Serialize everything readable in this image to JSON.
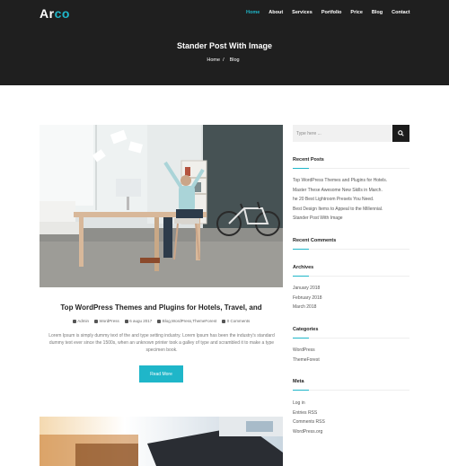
{
  "brand": {
    "name_main": "Ar",
    "name_accent": "co",
    "accent_color": "#1fb6c9"
  },
  "nav": [
    {
      "label": "Home",
      "active": true
    },
    {
      "label": "About"
    },
    {
      "label": "Services"
    },
    {
      "label": "Portfolio"
    },
    {
      "label": "Price"
    },
    {
      "label": "Blog"
    },
    {
      "label": "Contact"
    }
  ],
  "hero": {
    "title": "Stander Post With Image",
    "breadcrumb": {
      "home": "Home",
      "sep": "/",
      "current": "Blog"
    }
  },
  "post": {
    "title": "Top WordPress Themes and Plugins for Hotels, Travel, and",
    "meta": {
      "author": "Admin",
      "category": "WordPress",
      "date": "6 augu 2017",
      "tags": "Blog,WordPress,ThemeForest",
      "comments": "0 Comments"
    },
    "excerpt": "Lorem Ipsum is simply dummy text of the and type setting industry. Lorem Ipsum has been the industry's standard dummy text ever since the 1500s, when an unknown printer took a galley of type and scrambled it to make a type specimen book.",
    "read_more": "Read More"
  },
  "sidebar": {
    "search_placeholder": "Type here ...",
    "recent_posts_title": "Recent Posts",
    "recent_posts": [
      "Top WordPress Themes and Plugins for Hotels.",
      "Master These Awesome New Skills in March.",
      "he 20 Best Lightroom Presets You Need.",
      "Best Design Items to Appeal to the Millennial.",
      "Stander Post With Image"
    ],
    "recent_comments_title": "Recent Comments",
    "archives_title": "Archives",
    "archives": [
      "January 2018",
      "February 2018",
      "March 2018"
    ],
    "categories_title": "Categories",
    "categories": [
      "WordPress",
      "ThemeForest"
    ],
    "meta_title": "Meta",
    "meta_links": [
      "Log in",
      "Entries RSS",
      "Comments RSS",
      "WordPress.org"
    ]
  }
}
